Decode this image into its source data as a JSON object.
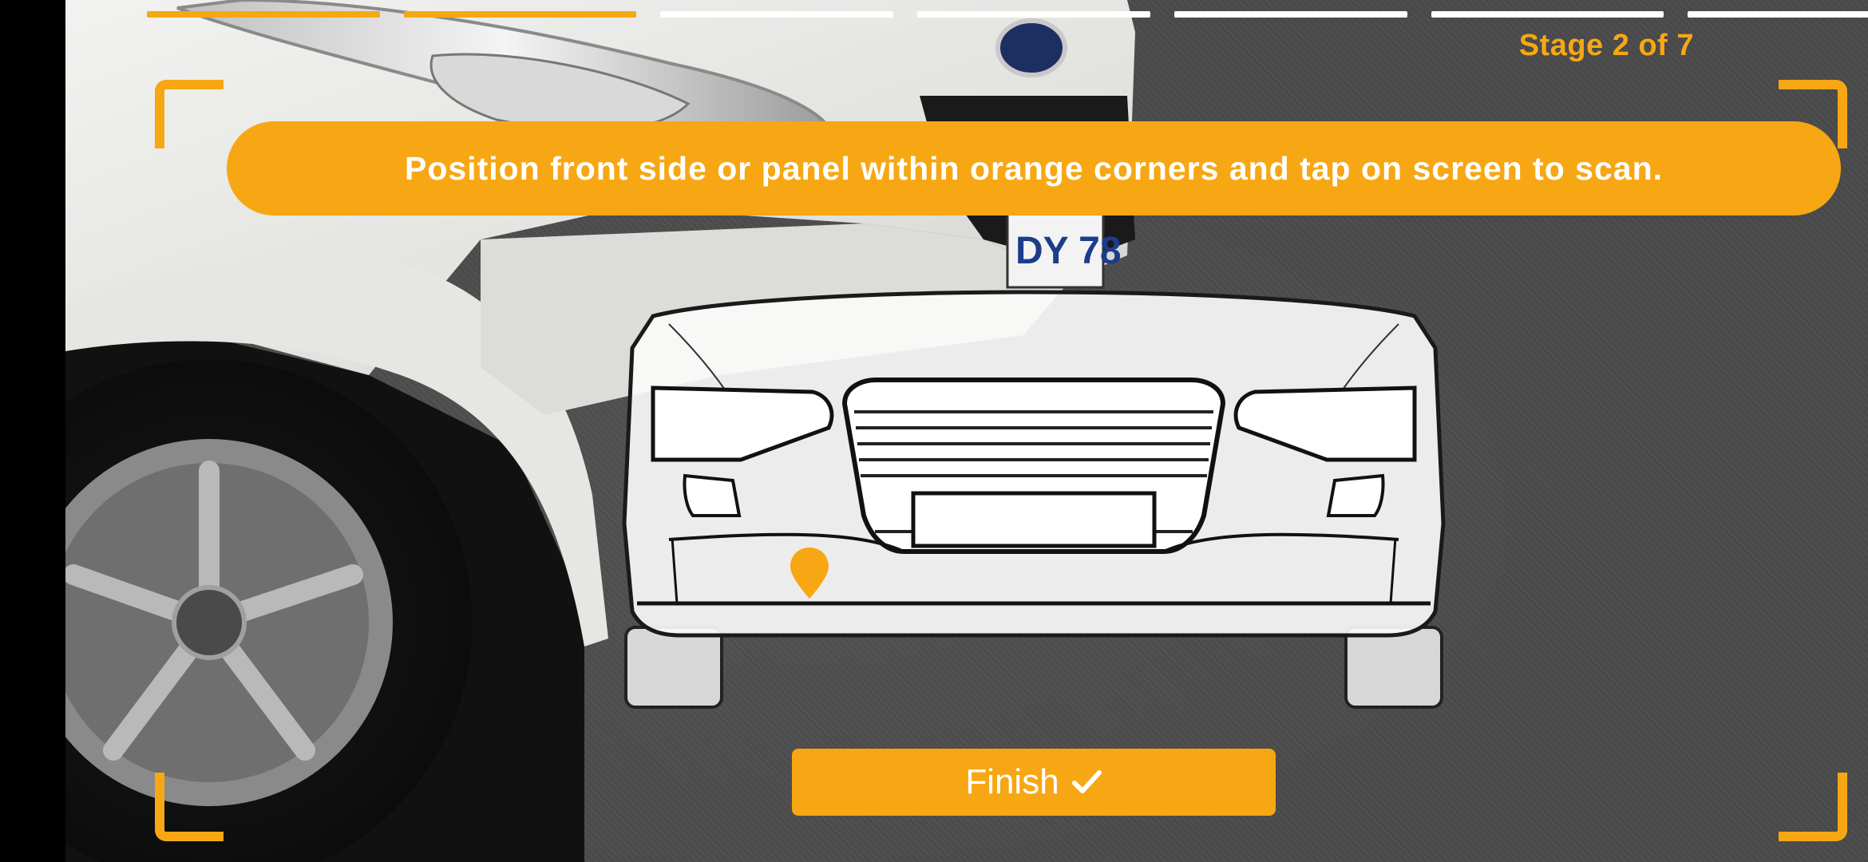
{
  "progress": {
    "total_stages": 7,
    "completed": 2
  },
  "stage_label": "Stage 2 of 7",
  "instruction": "Position front side or panel within orange corners and tap on screen to scan.",
  "finish_button": {
    "label": "Finish",
    "icon": "checkmark-icon"
  },
  "colors": {
    "accent": "#f7a713",
    "text_light": "#ffffff",
    "progress_pending": "#ffffff"
  },
  "photo": {
    "plate_text": "DY 78"
  }
}
